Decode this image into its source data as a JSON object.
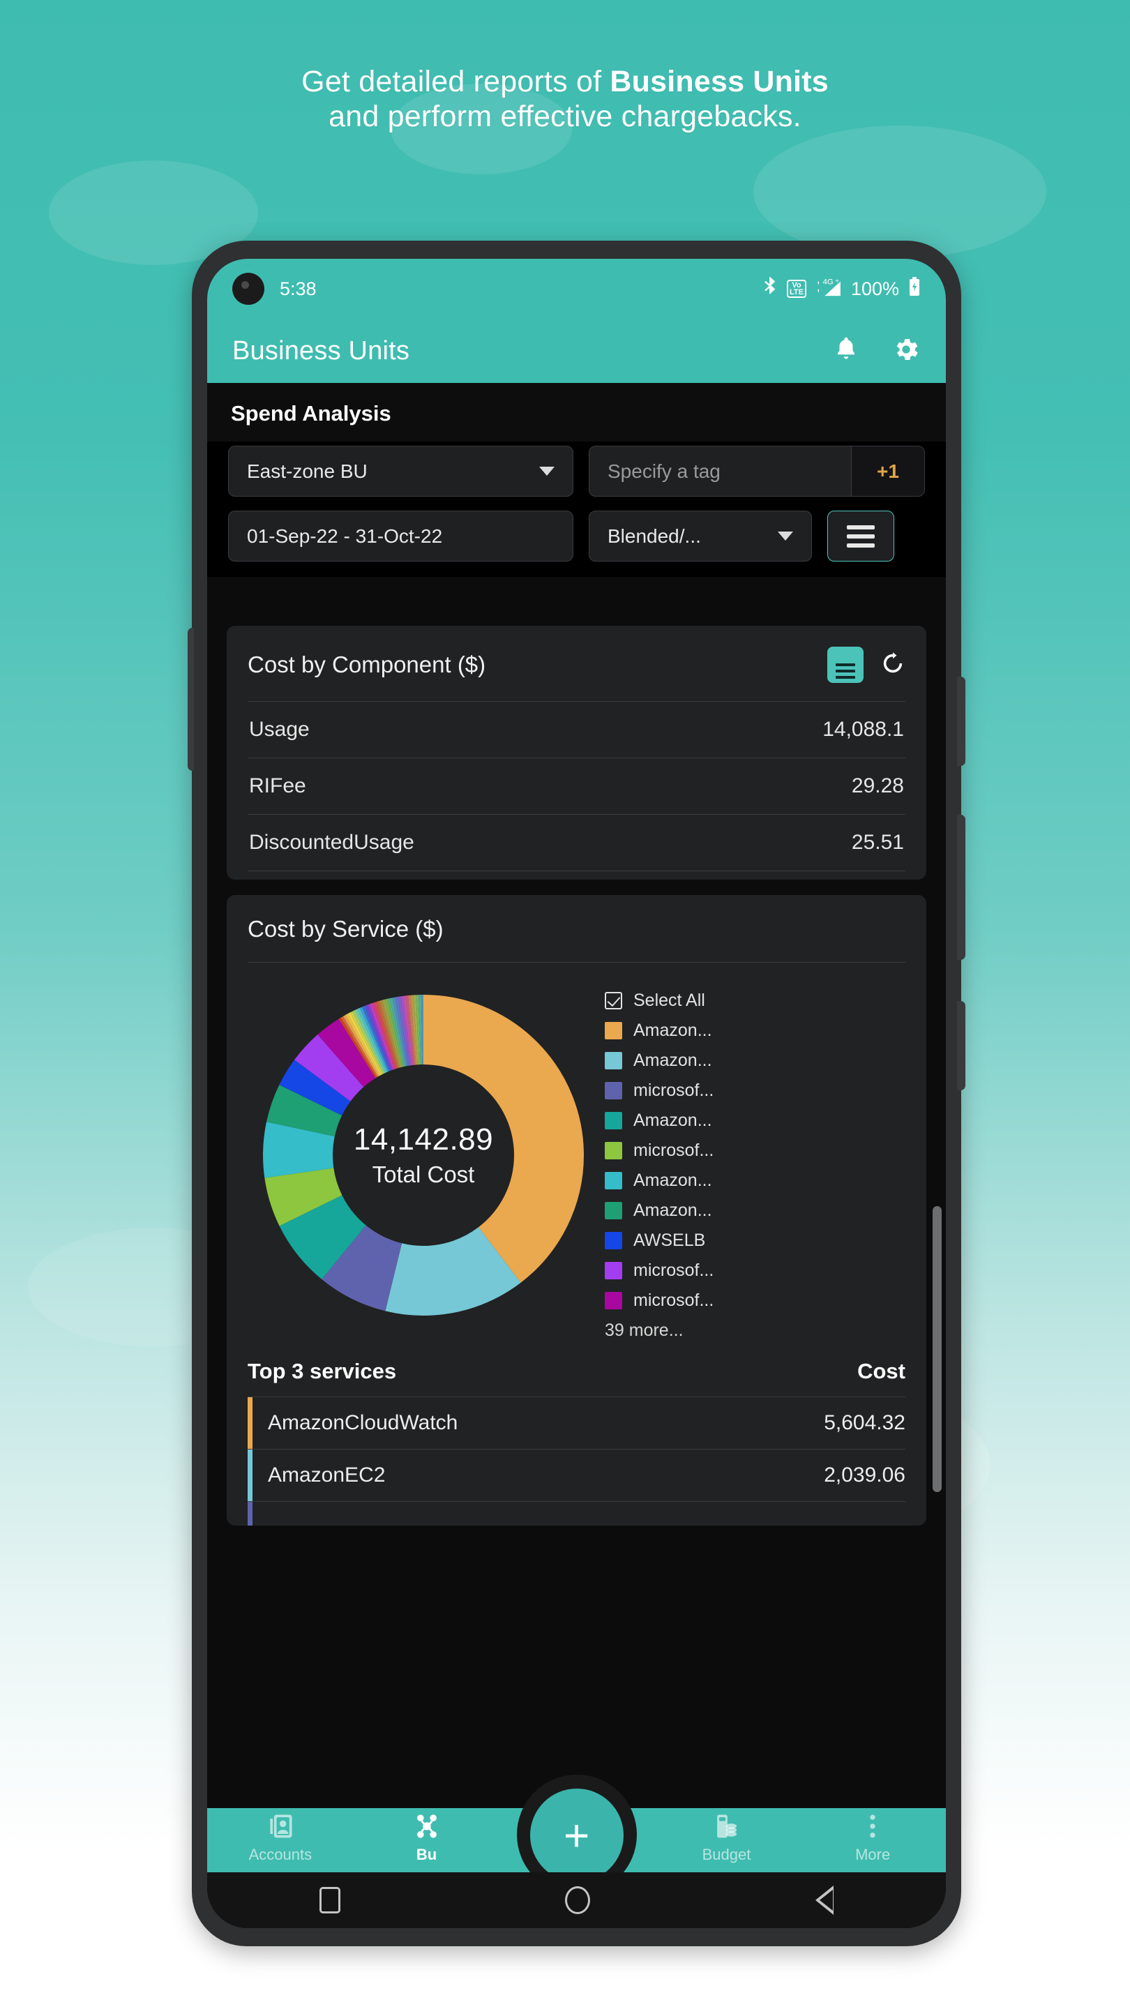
{
  "promo": {
    "line1_pre": "Get detailed reports of ",
    "line1_bold": "Business Units",
    "line2": "and perform effective chargebacks."
  },
  "theme": {
    "accent": "#3fbcb0",
    "accent_dark": "#3bb5ab",
    "card_bg": "#212223",
    "screen_bg": "#0c0c0c",
    "tag_plus": "#e0a44a"
  },
  "status_bar": {
    "time": "5:38",
    "battery": "100%",
    "volte_top": "VoLTE",
    "network": "4G+",
    "icons": [
      "camera-punch-hole-icon",
      "bluetooth-icon",
      "volte-icon",
      "signal-4g-plus-icon",
      "battery-icon"
    ]
  },
  "app_bar": {
    "title": "Business Units",
    "actions": [
      "notifications-bell-icon",
      "settings-gear-icon"
    ]
  },
  "section": {
    "title": "Spend Analysis"
  },
  "filters": {
    "business_unit": {
      "value": "East-zone BU",
      "icon": "chevron-down-icon"
    },
    "tag": {
      "placeholder": "Specify a tag",
      "extra_count": "+1"
    },
    "date_range": {
      "value": "01-Sep-22 - 31-Oct-22"
    },
    "cost_type": {
      "value": "Blended/...",
      "icon": "chevron-down-icon"
    },
    "menu_button": {
      "icon": "hamburger-menu-icon"
    }
  },
  "cost_by_component": {
    "title": "Cost by Component ($)",
    "actions": [
      "list-view-icon",
      "refresh-icon"
    ],
    "rows": [
      {
        "label": "Usage",
        "value": "14,088.1"
      },
      {
        "label": "RIFee",
        "value": "29.28"
      },
      {
        "label": "DiscountedUsage",
        "value": "25.51"
      }
    ]
  },
  "cost_by_service": {
    "title": "Cost by Service ($)",
    "donut": {
      "total": "14,142.89",
      "total_label": "Total Cost"
    },
    "legend": {
      "select_all": "Select All",
      "items": [
        {
          "label": "Amazon...",
          "color": "#eaa84f"
        },
        {
          "label": "Amazon...",
          "color": "#76c8d6"
        },
        {
          "label": "microsof...",
          "color": "#5f63ad"
        },
        {
          "label": "Amazon...",
          "color": "#16a79a"
        },
        {
          "label": "microsof...",
          "color": "#8dc63f"
        },
        {
          "label": "Amazon...",
          "color": "#35bdc9"
        },
        {
          "label": "Amazon...",
          "color": "#1e9f74"
        },
        {
          "label": "AWSELB",
          "color": "#1447e6"
        },
        {
          "label": "microsof...",
          "color": "#a23ef0"
        },
        {
          "label": "microsof...",
          "color": "#a8089f"
        }
      ],
      "more": "39 more..."
    },
    "top_table": {
      "header_name": "Top 3 services",
      "header_cost": "Cost",
      "rows": [
        {
          "name": "AmazonCloudWatch",
          "cost": "5,604.32",
          "color": "#eaa84f"
        },
        {
          "name": "AmazonEC2",
          "cost": "2,039.06",
          "color": "#76c8d6"
        }
      ]
    }
  },
  "chart_data": {
    "type": "pie",
    "title": "Cost by Service ($)",
    "center_value": 14142.89,
    "center_label": "Total Cost",
    "legend_position": "right",
    "categories": [
      "Amazon...",
      "Amazon...",
      "microsof...",
      "Amazon...",
      "microsof...",
      "Amazon...",
      "Amazon...",
      "AWSELB",
      "microsof...",
      "microsof...",
      "others (39 more)"
    ],
    "values": [
      39.6,
      14.2,
      7.1,
      6.8,
      5.0,
      5.6,
      3.9,
      2.9,
      3.4,
      2.6,
      8.9
    ],
    "colors": [
      "#eaa84f",
      "#76c8d6",
      "#5f63ad",
      "#16a79a",
      "#8dc63f",
      "#35bdc9",
      "#1e9f74",
      "#1447e6",
      "#a23ef0",
      "#a8089f",
      "#c8412a"
    ],
    "unit": "percent_of_total",
    "top_services": {
      "AmazonCloudWatch": 5604.32,
      "AmazonEC2": 2039.06
    },
    "components": {
      "Usage": 14088.1,
      "RIFee": 29.28,
      "DiscountedUsage": 25.51
    }
  },
  "bottom_nav": {
    "items": [
      {
        "label": "Accounts",
        "icon": "accounts-icon",
        "active": false
      },
      {
        "label": "Bu",
        "icon": "business-units-icon",
        "active": true
      },
      {
        "label": "Budget",
        "icon": "budget-icon",
        "active": false
      },
      {
        "label": "More",
        "icon": "more-dots-icon",
        "active": false
      }
    ],
    "fab": {
      "label": "+",
      "icon": "add-icon"
    }
  },
  "android_nav": {
    "recents": "recents-square-icon",
    "home": "home-circle-icon",
    "back": "back-triangle-icon"
  }
}
